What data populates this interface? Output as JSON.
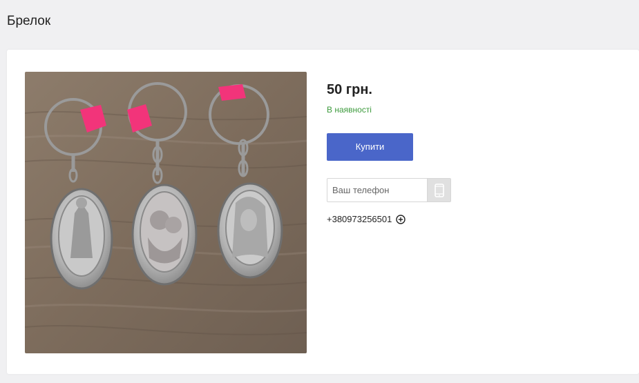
{
  "page": {
    "title": "Брелок"
  },
  "product": {
    "price": "50 грн.",
    "availability": "В наявності",
    "buy_label": "Купити",
    "image_icon": "keychain-photo"
  },
  "callback": {
    "phone_placeholder": "Ваш телефон",
    "submit_icon": "mobile-phone-icon"
  },
  "contact": {
    "phone": "+380973256501",
    "expand_icon": "plus-circle-icon"
  },
  "colors": {
    "accent": "#4a66c9",
    "availability": "#3c9a3c",
    "background": "#f0f0f2"
  }
}
